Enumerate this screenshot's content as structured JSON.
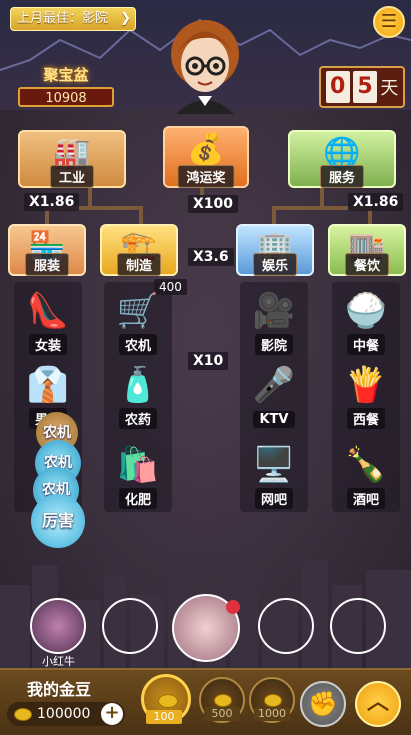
{
  "header": {
    "best_last_month": "上月最佳：影院",
    "jubaopen_title": "聚宝盆",
    "jubaopen_value": "10908",
    "countdown_digits": [
      "0",
      "5"
    ],
    "countdown_unit": "天"
  },
  "top_nodes": [
    {
      "label": "工业",
      "icon": "oil-pump-icon",
      "glyph": "🏭"
    },
    {
      "label": "鸿运奖",
      "icon": "money-bag-icon",
      "glyph": "💰"
    },
    {
      "label": "服务",
      "icon": "globe-hands-icon",
      "glyph": "🌐"
    }
  ],
  "multipliers": {
    "left": "X1.86",
    "center": "X100",
    "right": "X1.86",
    "mid": "X3.6",
    "inner": "X10"
  },
  "sub_nodes": [
    {
      "label": "服装",
      "glyph": "🏪"
    },
    {
      "label": "制造",
      "glyph": "🏗️"
    },
    {
      "label": "娱乐",
      "glyph": "🏢"
    },
    {
      "label": "餐饮",
      "glyph": "🏬"
    }
  ],
  "column_badge": "400",
  "items": [
    {
      "label": "女装",
      "glyph": "👠",
      "icon": "high-heel-icon"
    },
    {
      "label": "农机",
      "glyph": "🛒",
      "icon": "wheelbarrow-icon"
    },
    {
      "label": "影院",
      "glyph": "🎥",
      "icon": "projector-icon"
    },
    {
      "label": "中餐",
      "glyph": "🍚",
      "icon": "rice-bowl-icon"
    },
    {
      "label": "男装",
      "glyph": "👔",
      "icon": "shirt-tie-icon"
    },
    {
      "label": "农药",
      "glyph": "🧴",
      "icon": "pesticide-bottle-icon"
    },
    {
      "label": "KTV",
      "glyph": "🎤",
      "icon": "microphone-icon"
    },
    {
      "label": "西餐",
      "glyph": "🍟",
      "icon": "fries-icon"
    },
    {
      "label": "化肥",
      "glyph": "🛍️",
      "icon": "fertilizer-bag-icon"
    },
    {
      "label": "网吧",
      "glyph": "🖥️",
      "icon": "monitor-icon"
    },
    {
      "label": "酒吧",
      "glyph": "🍾",
      "icon": "bottle-icon"
    }
  ],
  "bubbles": [
    "农机",
    "农机",
    "农机",
    "厉害"
  ],
  "seats": {
    "player1_name": "小红牛"
  },
  "bottom": {
    "bean_label": "我的金豆",
    "bean_balance": "100000",
    "plus": "+",
    "chips": [
      "100",
      "500",
      "1000"
    ],
    "up_glyph": "︿",
    "fist_glyph": "✊"
  }
}
